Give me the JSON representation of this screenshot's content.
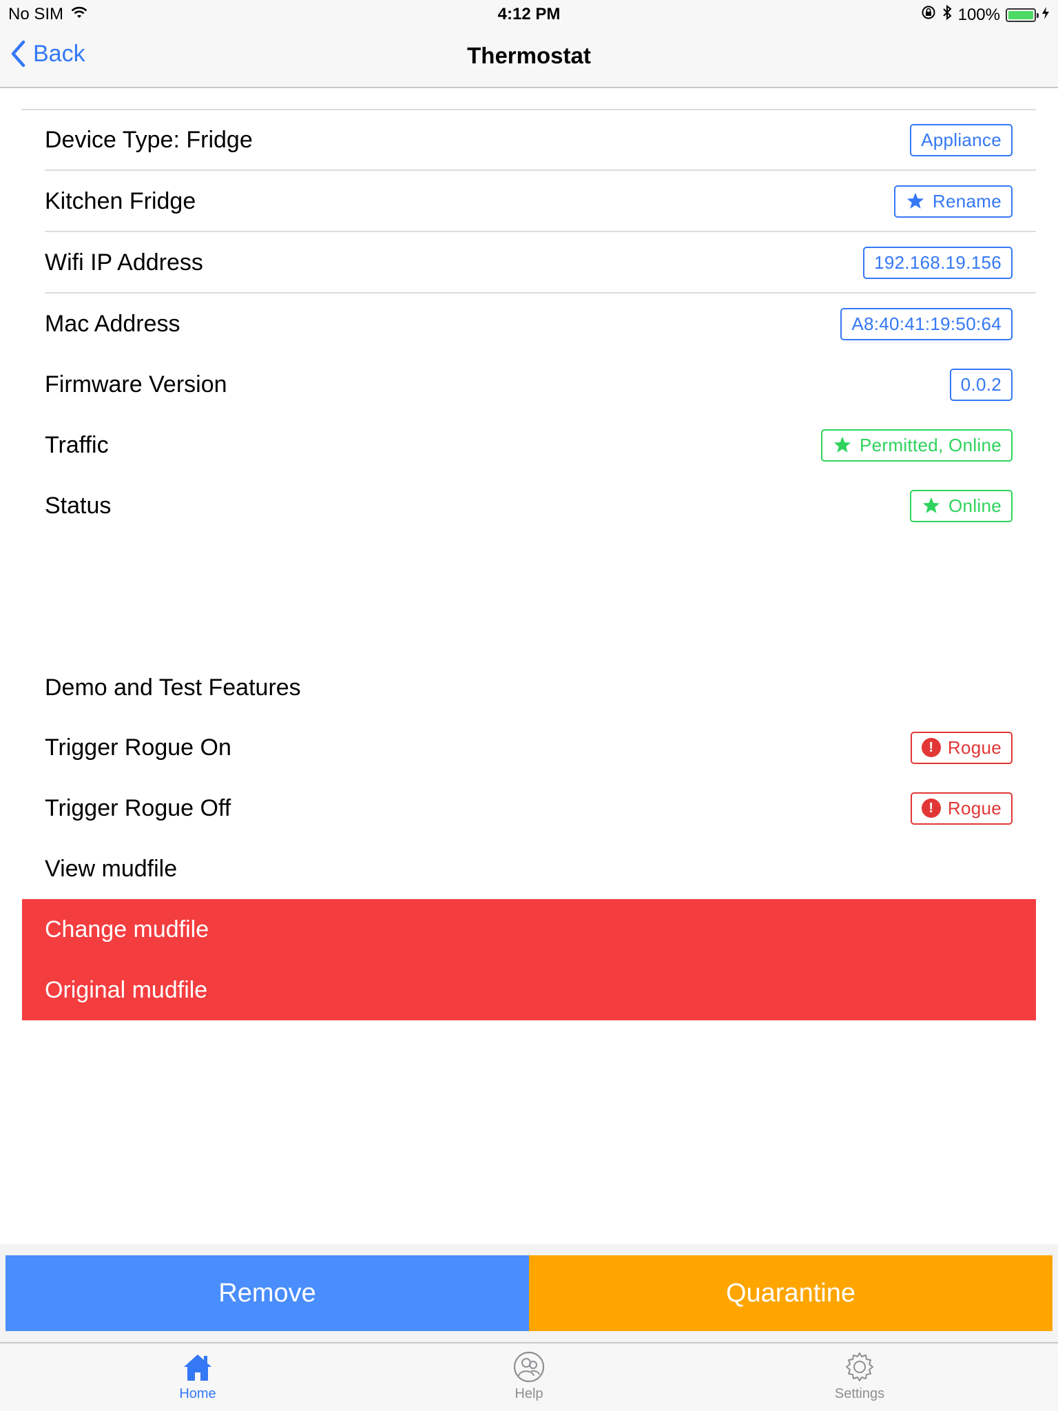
{
  "status_bar": {
    "carrier": "No SIM",
    "time": "4:12 PM",
    "battery_percent": "100%",
    "battery_color": "#4cd964"
  },
  "nav": {
    "back_label": "Back",
    "title": "Thermostat"
  },
  "rows": [
    {
      "label": "Device Type: Fridge",
      "tag": "Appliance",
      "tag_color": "blue",
      "tag_icon": ""
    },
    {
      "label": "Kitchen Fridge",
      "tag": "Rename",
      "tag_color": "blue",
      "tag_icon": "star-icon"
    },
    {
      "label": "Wifi IP Address",
      "tag": "192.168.19.156",
      "tag_color": "blue",
      "tag_icon": ""
    },
    {
      "label": "Mac Address",
      "tag": "A8:40:41:19:50:64",
      "tag_color": "blue",
      "tag_icon": ""
    },
    {
      "label": "Firmware Version",
      "tag": "0.0.2",
      "tag_color": "blue",
      "tag_icon": ""
    },
    {
      "label": "Traffic",
      "tag": "Permitted, Online",
      "tag_color": "green",
      "tag_icon": "star-icon"
    },
    {
      "label": "Status",
      "tag": "Online",
      "tag_color": "green",
      "tag_icon": "star-icon"
    }
  ],
  "demo": {
    "section_label": "Demo and Test Features",
    "rows": [
      {
        "label": "Trigger Rogue On",
        "tag": "Rogue",
        "tag_icon": "exclamation-icon",
        "exclamation": "!"
      },
      {
        "label": "Trigger Rogue Off",
        "tag": "Rogue",
        "tag_icon": "exclamation-icon",
        "exclamation": "!"
      },
      {
        "label": "View mudfile"
      }
    ],
    "red_rows": [
      {
        "label": "Change mudfile"
      },
      {
        "label": "Original mudfile"
      }
    ],
    "red_block_color": "#f43d3f"
  },
  "actions": {
    "remove_label": "Remove",
    "quarantine_label": "Quarantine",
    "remove_color": "#4a8dfc",
    "quarantine_color": "#ffa500"
  },
  "tabs": [
    {
      "label": "Home",
      "icon": "home-icon",
      "active": true
    },
    {
      "label": "Help",
      "icon": "help-icon",
      "active": false
    },
    {
      "label": "Settings",
      "icon": "gear-icon",
      "active": false
    }
  ],
  "colors": {
    "accent": "#3478f6",
    "green": "#2dd35c",
    "red": "#e23636"
  }
}
